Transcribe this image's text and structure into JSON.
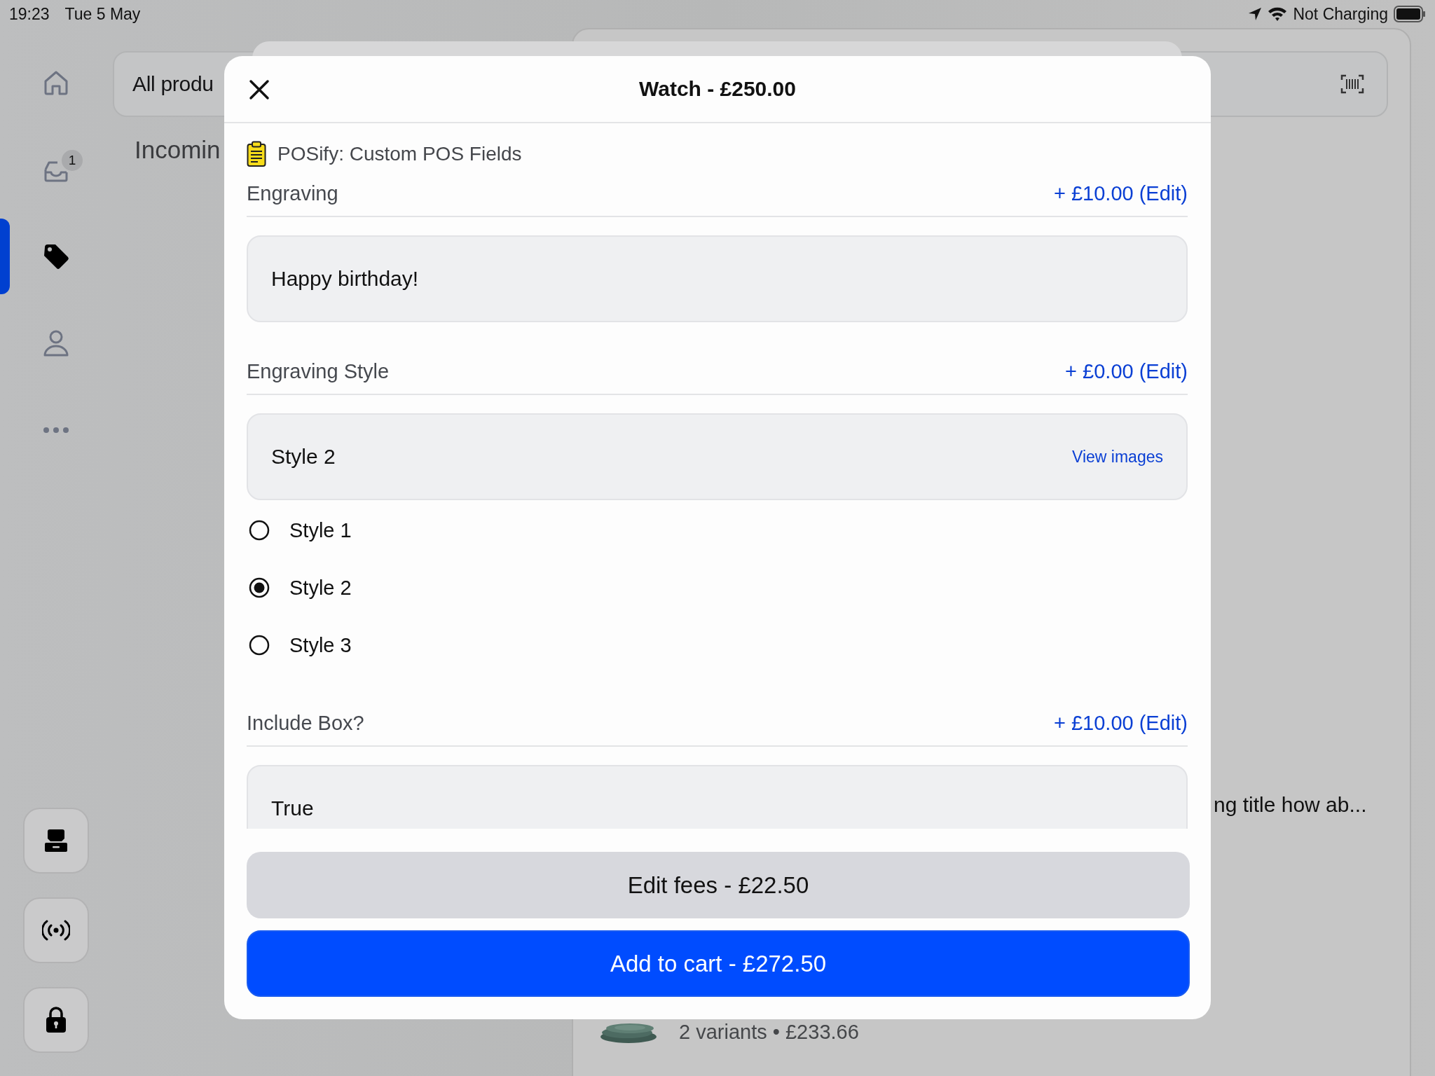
{
  "status_bar": {
    "time": "19:23",
    "date": "Tue 5 May",
    "charging": "Not Charging"
  },
  "sidebar": {
    "items": [
      {
        "kind": "home",
        "selected": false
      },
      {
        "kind": "inbox",
        "selected": false,
        "badge": "1"
      },
      {
        "kind": "tag",
        "selected": true
      },
      {
        "kind": "person",
        "selected": false
      },
      {
        "kind": "more",
        "selected": false
      }
    ],
    "actions": [
      {
        "kind": "register"
      },
      {
        "kind": "broadcast"
      },
      {
        "kind": "lock"
      }
    ]
  },
  "background": {
    "search": "All produ",
    "section": "Incomin",
    "product_title": "ng title how ab...",
    "product_meta": "2 variants • £233.66"
  },
  "modal": {
    "title": "Watch - £250.00",
    "app_name": "POSify: Custom POS Fields",
    "fields": [
      {
        "kind": "text",
        "label": "Engraving",
        "price": "+ £10.00 (Edit)",
        "value": "Happy birthday!"
      },
      {
        "kind": "choice",
        "label": "Engraving Style",
        "price": "+ £0.00 (Edit)",
        "value": "Style 2",
        "link": "View images",
        "options": [
          {
            "label": "Style 1",
            "selected": false
          },
          {
            "label": "Style 2",
            "selected": true
          },
          {
            "label": "Style 3",
            "selected": false
          }
        ]
      },
      {
        "kind": "text",
        "label": "Include Box?",
        "price": "+ £10.00 (Edit)",
        "value": "True"
      }
    ],
    "buttons": [
      {
        "kind": "secondary",
        "label": "Edit fees - £22.50"
      },
      {
        "kind": "primary",
        "label": "Add to cart - £272.50"
      }
    ]
  }
}
